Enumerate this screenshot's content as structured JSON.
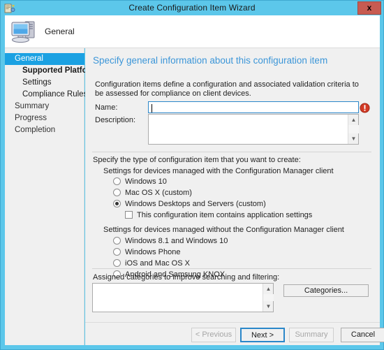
{
  "window": {
    "title": "Create Configuration Item Wizard",
    "titlebar_icon": "wizard-icon",
    "close_label": "x",
    "accent_color": "#5CC7EA",
    "close_button_color": "#C75B51"
  },
  "header": {
    "icon": "computer-icon",
    "page_name": "General"
  },
  "sidebar": {
    "items": [
      {
        "label": "General",
        "level": 0,
        "active": true
      },
      {
        "label": "Supported Platforms",
        "level": 1,
        "active": false,
        "bold": true
      },
      {
        "label": "Settings",
        "level": 1,
        "active": false,
        "bold": false
      },
      {
        "label": "Compliance Rules",
        "level": 1,
        "active": false,
        "bold": false
      },
      {
        "label": "Summary",
        "level": 0,
        "active": false
      },
      {
        "label": "Progress",
        "level": 0,
        "active": false
      },
      {
        "label": "Completion",
        "level": 0,
        "active": false
      }
    ],
    "active_color": "#1BA1E2"
  },
  "main": {
    "heading": "Specify general information about this configuration item",
    "heading_color": "#3C96D8",
    "intro": "Configuration items define a configuration and associated validation criteria to be assessed for compliance on client devices.",
    "name": {
      "label": "Name:",
      "value": "",
      "placeholder": "",
      "has_error": true,
      "error_icon": "error-icon"
    },
    "description": {
      "label": "Description:",
      "value": "",
      "placeholder": ""
    },
    "type_section": {
      "prompt": "Specify the type of configuration item that you want to create:",
      "managed_group": {
        "label": "Settings for devices managed with the Configuration Manager client",
        "options": [
          {
            "label": "Windows 10",
            "selected": false
          },
          {
            "label": "Mac OS X (custom)",
            "selected": false
          },
          {
            "label": "Windows Desktops and Servers (custom)",
            "selected": true
          }
        ],
        "checkbox": {
          "label": "This configuration item contains application settings",
          "checked": false
        }
      },
      "unmanaged_group": {
        "label": "Settings for devices managed without the Configuration Manager client",
        "options": [
          {
            "label": "Windows 8.1 and Windows 10",
            "selected": false
          },
          {
            "label": "Windows Phone",
            "selected": false
          },
          {
            "label": "iOS and Mac OS X",
            "selected": false
          },
          {
            "label": "Android and Samsung KNOX",
            "selected": false
          }
        ]
      }
    },
    "categories": {
      "label": "Assigned categories to improve searching and filtering:",
      "list_value": "",
      "button_label": "Categories..."
    }
  },
  "footer": {
    "buttons": [
      {
        "label": "< Previous",
        "state": "disabled"
      },
      {
        "label": "Next >",
        "state": "focused"
      },
      {
        "label": "Summary",
        "state": "disabled"
      },
      {
        "label": "Cancel",
        "state": "enabled"
      }
    ]
  }
}
